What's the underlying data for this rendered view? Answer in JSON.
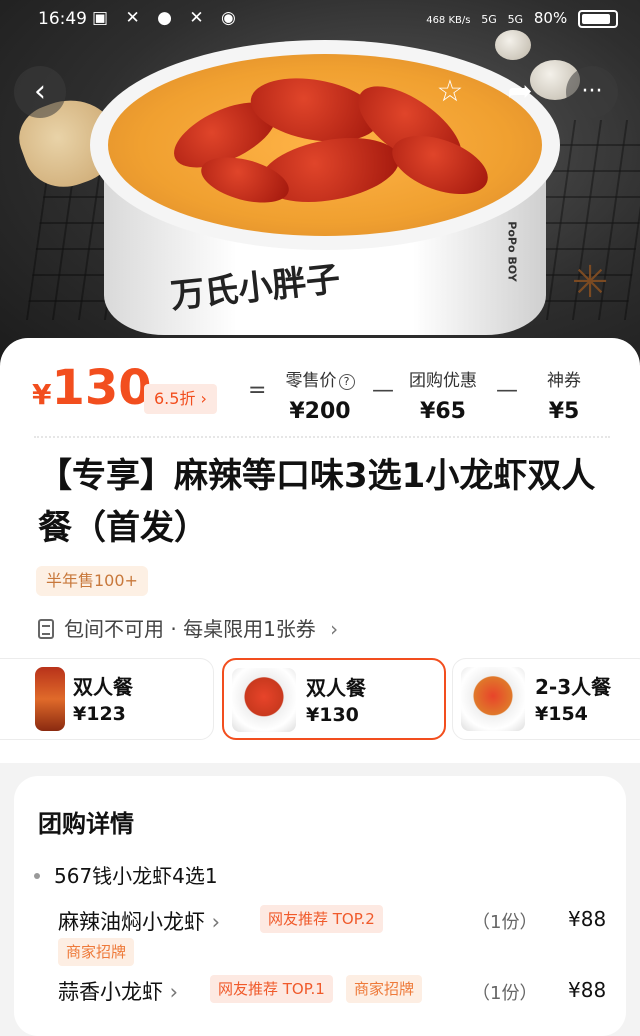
{
  "status_bar": {
    "time": "16:49",
    "net_speed": "468 KB/s",
    "signal1": "5G",
    "signal2": "5G",
    "battery": "80%"
  },
  "hero": {
    "brand_text": "万氏小胖子",
    "brand_side": "PoPo BOY"
  },
  "nav": {
    "back_icon": "‹",
    "fav_icon": "☆",
    "share_icon": "➦",
    "more_icon": "···"
  },
  "price": {
    "currency": "¥",
    "amount": "130",
    "discount": "6.5折",
    "equals": "=",
    "minus": "—",
    "retail_label": "零售价",
    "retail_value": "¥200",
    "group_label": "团购优惠",
    "group_value": "¥65",
    "coupon_label": "神券",
    "coupon_value": "¥5"
  },
  "product": {
    "title": "【专享】麻辣等口味3选1小龙虾双人餐（首发）",
    "sold": "半年售100+",
    "rule": "包间不可用 · 每桌限用1张券"
  },
  "options": [
    {
      "name": "双人餐",
      "price": "¥123"
    },
    {
      "name": "双人餐",
      "price": "¥130"
    },
    {
      "name": "2-3人餐",
      "price": "¥154"
    }
  ],
  "details": {
    "heading": "团购详情",
    "group_title": "567钱小龙虾4选1",
    "items": [
      {
        "name": "麻辣油焖小龙虾",
        "tag1": "网友推荐 TOP.2",
        "tag2": "商家招牌",
        "qty": "（1份）",
        "price": "¥88"
      },
      {
        "name": "蒜香小龙虾",
        "tag1": "网友推荐 TOP.1",
        "tag2": "商家招牌",
        "qty": "（1份）",
        "price": "¥88"
      }
    ]
  }
}
